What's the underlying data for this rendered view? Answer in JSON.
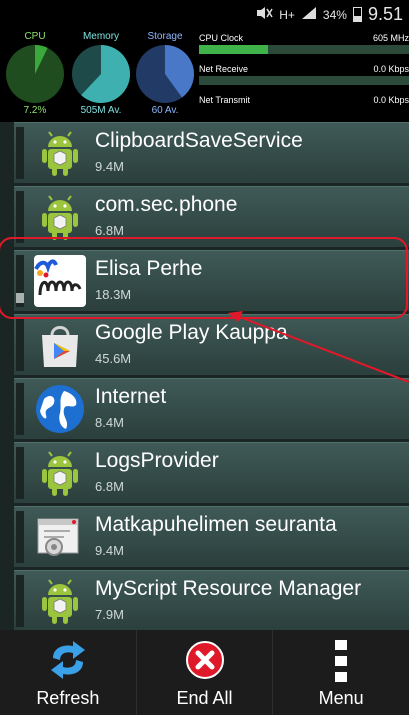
{
  "status_bar": {
    "network": "H+",
    "battery": "34%",
    "time": "9.51"
  },
  "monitor": {
    "cpu": {
      "title": "CPU",
      "value": "7.2%",
      "level": 0.072,
      "color": "#3aa83a"
    },
    "memory": {
      "title": "Memory",
      "value": "505M Av.",
      "level": 0.62,
      "color": "#3fb0b0"
    },
    "storage": {
      "title": "Storage",
      "value": "60 Av.",
      "level": 0.4,
      "color": "#4a78c8"
    },
    "stats": [
      {
        "label": "CPU Clock",
        "value": "605 MHz",
        "fill": 0.33
      },
      {
        "label": "Net Receive",
        "value": "0.0 Kbps",
        "fill": 0.0
      },
      {
        "label": "Net Transmit",
        "value": "0.0 Kbps",
        "fill": 0.0
      }
    ]
  },
  "apps": [
    {
      "name": "ClipboardSaveService",
      "size": "9.4M",
      "icon": "android-icon"
    },
    {
      "name": "com.sec.phone",
      "size": "6.8M",
      "icon": "android-icon"
    },
    {
      "name": "Elisa Perhe",
      "size": "18.3M",
      "icon": "elisa-perhe-icon"
    },
    {
      "name": "Google Play Kauppa",
      "size": "45.6M",
      "icon": "google-play-icon"
    },
    {
      "name": "Internet",
      "size": "8.4M",
      "icon": "globe-icon"
    },
    {
      "name": "LogsProvider",
      "size": "6.8M",
      "icon": "android-icon"
    },
    {
      "name": "Matkapuhelimen seuranta",
      "size": "9.4M",
      "icon": "settings-window-icon"
    },
    {
      "name": "MyScript Resource Manager",
      "size": "7.9M",
      "icon": "android-icon"
    }
  ],
  "bottom_bar": {
    "refresh": "Refresh",
    "end_all": "End All",
    "menu": "Menu"
  },
  "colors": {
    "annotation": "#e0192a",
    "android_green": "#9bc53d"
  }
}
